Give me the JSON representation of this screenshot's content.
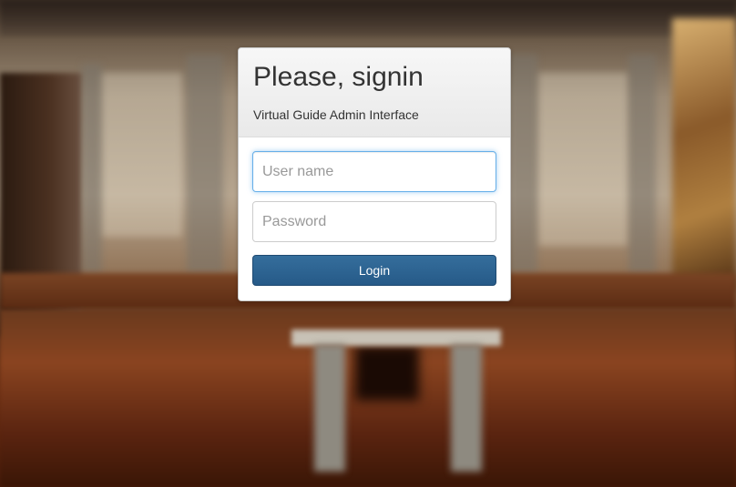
{
  "login": {
    "title": "Please, signin",
    "subtitle": "Virtual Guide Admin Interface",
    "username_placeholder": "User name",
    "username_value": "",
    "password_placeholder": "Password",
    "password_value": "",
    "submit_label": "Login"
  },
  "colors": {
    "button_primary": "#265a88",
    "focus_ring": "#66afe9"
  }
}
